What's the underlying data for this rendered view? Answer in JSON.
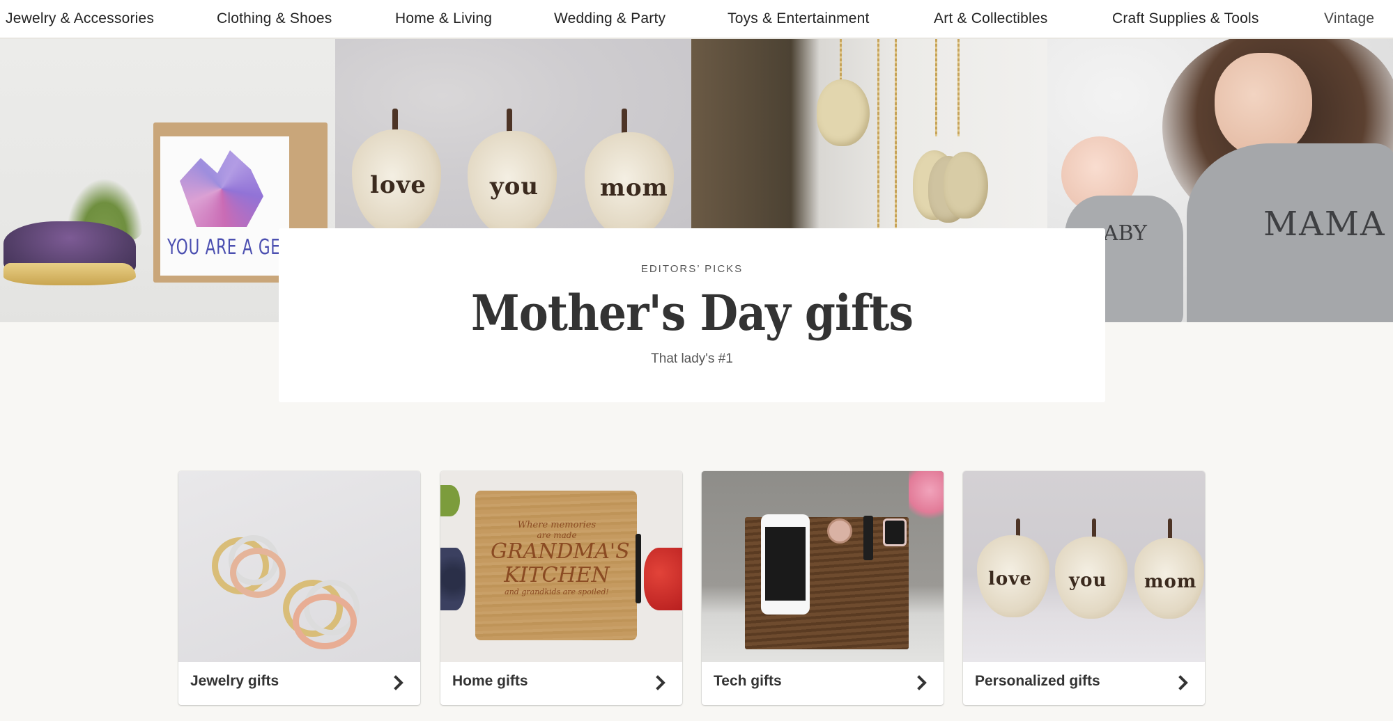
{
  "nav": {
    "items": [
      {
        "label": "Jewelry & Accessories"
      },
      {
        "label": "Clothing & Shoes"
      },
      {
        "label": "Home & Living"
      },
      {
        "label": "Wedding & Party"
      },
      {
        "label": "Toys & Entertainment"
      },
      {
        "label": "Art & Collectibles"
      },
      {
        "label": "Craft Supplies & Tools"
      },
      {
        "label": "Vintage"
      }
    ]
  },
  "hero": {
    "images": [
      {
        "alt": "Amethyst air plant with 'You are a gem' gift box",
        "text": "YOU ARE A GEM"
      },
      {
        "alt": "Ceramic pears 'love you mom'",
        "words": [
          "love",
          "you",
          "mom"
        ]
      },
      {
        "alt": "Gold silhouette charm necklaces"
      },
      {
        "alt": "Mama and baby bear matching shirts",
        "words": [
          "MAMA",
          "ABY"
        ]
      }
    ]
  },
  "feature": {
    "eyebrow": "EDITORS’ PICKS",
    "title": "Mother's Day gifts",
    "subtitle": "That lady's #1"
  },
  "gifts": [
    {
      "label": "Jewelry gifts",
      "icon": "chevron-right-icon"
    },
    {
      "label": "Home gifts",
      "icon": "chevron-right-icon",
      "board_text": [
        "Where memories",
        "are made",
        "GRANDMA'S",
        "KITCHEN",
        "and grandkids are spoiled!"
      ]
    },
    {
      "label": "Tech gifts",
      "icon": "chevron-right-icon"
    },
    {
      "label": "Personalized gifts",
      "icon": "chevron-right-icon",
      "words": [
        "love",
        "you",
        "mom"
      ]
    }
  ]
}
